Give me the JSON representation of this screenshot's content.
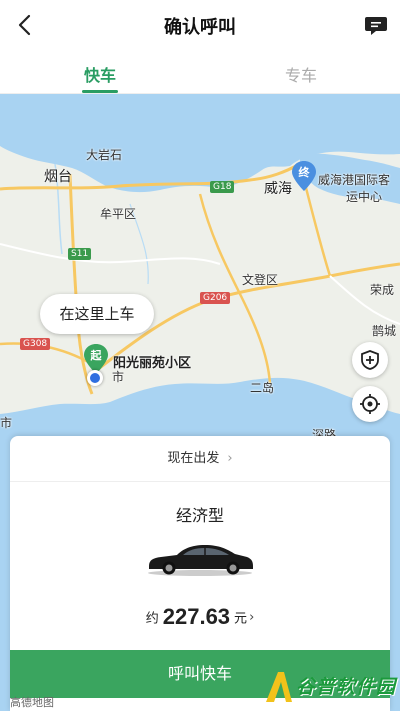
{
  "header": {
    "title": "确认呼叫",
    "back_icon": "back-arrow-icon",
    "message_icon": "message-icon"
  },
  "tabs": [
    {
      "label": "快车",
      "active": true
    },
    {
      "label": "专车",
      "active": false
    }
  ],
  "map": {
    "labels": {
      "dayanshi": "大岩石",
      "yantai": "烟台",
      "muping": "牟平区",
      "weihai": "威海",
      "weihai_port": "威海港国际客",
      "weihai_port2": "运中心",
      "wendeng": "文登区",
      "rongcheng": "荣成",
      "erdao": "二岛",
      "zhenshi": "鹊城",
      "shi": "市",
      "shi2": "市",
      "shendao": "深路"
    },
    "roads": {
      "g18": "G18",
      "s11": "S11",
      "g206": "G206",
      "g308": "G308"
    },
    "pickup_bubble": "在这里上车",
    "start_pin": "起",
    "end_pin": "终",
    "start_name": "阳光丽苑小区",
    "colors": {
      "water": "#a9d3f2",
      "land": "#eef0ea",
      "road_major": "#f7c862",
      "accent": "#2a9d63",
      "end_pin": "#4a8fe0"
    }
  },
  "card": {
    "depart_label": "现在出发",
    "car_type": "经济型",
    "price_prefix": "约",
    "price_value": "227.63",
    "price_unit": "元",
    "call_button": "呼叫快车"
  },
  "footer": {
    "map_logo": "高德地图",
    "watermark": "谷普软件园"
  }
}
